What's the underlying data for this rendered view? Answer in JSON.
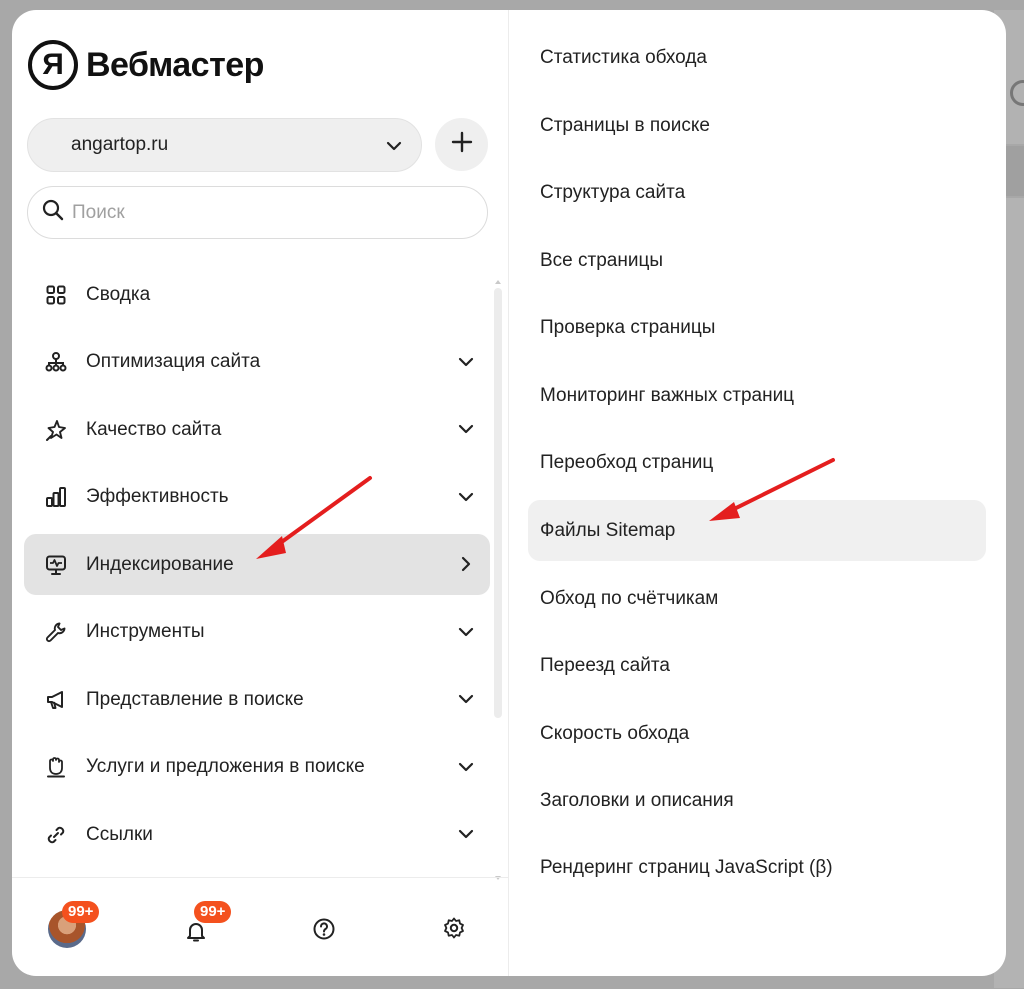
{
  "logo": {
    "mark": "Я",
    "text": "Вебмастер"
  },
  "site_selector": {
    "value": "angartop.ru"
  },
  "search": {
    "placeholder": "Поиск"
  },
  "nav": {
    "items": [
      {
        "label": "Сводка",
        "icon": "grid-icon",
        "has_chevron": false
      },
      {
        "label": "Оптимизация сайта",
        "icon": "sitemap-icon",
        "has_chevron": true
      },
      {
        "label": "Качество сайта",
        "icon": "sparkle-star-icon",
        "has_chevron": true
      },
      {
        "label": "Эффективность",
        "icon": "bar-chart-icon",
        "has_chevron": true
      },
      {
        "label": "Индексирование",
        "icon": "monitor-pulse-icon",
        "has_chevron": true,
        "active": true
      },
      {
        "label": "Инструменты",
        "icon": "wrench-icon",
        "has_chevron": true
      },
      {
        "label": "Представление в поиске",
        "icon": "megaphone-icon",
        "has_chevron": true
      },
      {
        "label": "Услуги и предложения в поиске",
        "icon": "hand-icon",
        "has_chevron": true
      },
      {
        "label": "Ссылки",
        "icon": "link-icon",
        "has_chevron": true
      }
    ]
  },
  "footer": {
    "profile_badge": "99+",
    "notifications_badge": "99+"
  },
  "submenu": {
    "items": [
      {
        "label": "Статистика обхода"
      },
      {
        "label": "Страницы в поиске"
      },
      {
        "label": "Структура сайта"
      },
      {
        "label": "Все страницы"
      },
      {
        "label": "Проверка страницы"
      },
      {
        "label": "Мониторинг важных страниц"
      },
      {
        "label": "Переобход страниц"
      },
      {
        "label": "Файлы Sitemap",
        "active": true
      },
      {
        "label": "Обход по счётчикам"
      },
      {
        "label": "Переезд сайта"
      },
      {
        "label": "Скорость обхода"
      },
      {
        "label": "Заголовки и описания"
      },
      {
        "label": "Рендеринг страниц JavaScript (β)"
      }
    ]
  },
  "colors": {
    "accent_badge": "#f4511e",
    "annotation_arrow": "#e41e1e",
    "active_item_bg": "#e3e3e3"
  }
}
